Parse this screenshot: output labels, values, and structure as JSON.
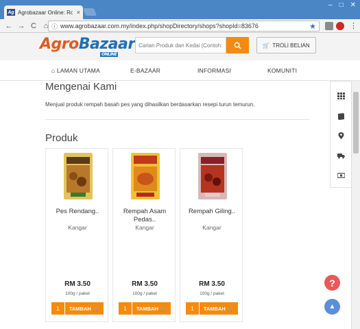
{
  "browser": {
    "tab_title": "Agrobazaar Online: Rom",
    "tab_close": "×",
    "favicon_text": "Ag",
    "url": "www.agrobazaar.com.my/index.php/shopDirectory/shops?shopId=83676",
    "back": "←",
    "forward": "→",
    "reload": "C",
    "home": "⌂",
    "info": "ⓘ",
    "star": "★",
    "menu": "⋮",
    "min": "–",
    "max": "□",
    "close": "✕"
  },
  "header": {
    "logo_part1": "Agro",
    "logo_part2": "Bazaar",
    "logo_online": "ONLINE",
    "search_placeholder": "Carian Produk dan Kedai (Contoh: Ko",
    "search_icon": "search-icon",
    "cart_label": "TROLI BELIAN",
    "cart_icon": "🛒"
  },
  "nav": {
    "home": "⌂ LAMAN UTAMA",
    "ebazaar": "E-BAZAAR",
    "info": "INFORMASI",
    "community": "KOMUNITI"
  },
  "about": {
    "title": "Mengenai Kami",
    "text": "Menjual produk rempah basah pes yang dihasilkan berdasarkan resepi turun temurun."
  },
  "products": {
    "title": "Produk",
    "items": [
      {
        "name": "Pes Rendang..",
        "location": "Kangar",
        "price": "RM 3.50",
        "unit": "100g / paket",
        "add_label": "TAMBAH",
        "qty_label": "1",
        "color": "#c69a2e"
      },
      {
        "name": "Rempah Asam Pedas..",
        "location": "Kangar",
        "price": "RM 3.50",
        "unit": "100g / paket",
        "add_label": "TAMBAH",
        "qty_label": "1",
        "color": "#d9a62a"
      },
      {
        "name": "Rempah Giling..",
        "location": "Kangar",
        "price": "RM 3.50",
        "unit": "100g / paket",
        "add_label": "TAMBAH",
        "qty_label": "1",
        "color": "#b33b1f"
      }
    ]
  },
  "side_panel": {
    "icons": [
      "grid-icon",
      "book-icon",
      "location-pin-icon",
      "truck-icon",
      "money-icon"
    ]
  },
  "fab": {
    "help": "?",
    "top": "▲"
  },
  "colors": {
    "accent": "#f58a0e",
    "brand_orange": "#e05a1e",
    "brand_blue": "#1f6fb5",
    "help": "#e55a5a",
    "scroll_top": "#5b8fd6"
  }
}
